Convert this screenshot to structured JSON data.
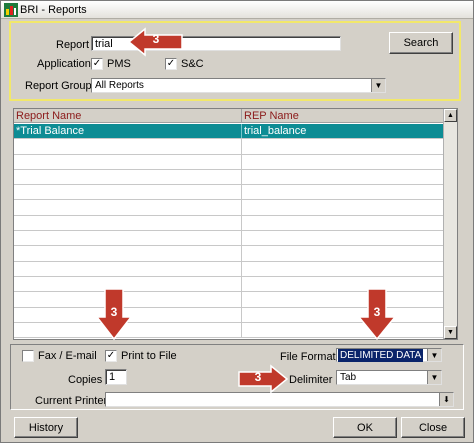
{
  "window": {
    "title": "BRI - Reports"
  },
  "criteria": {
    "report_label": "Report",
    "report_value": "trial",
    "search_button": "Search",
    "application_label": "Application",
    "pms_label": "PMS",
    "pms_checked": true,
    "sc_label": "S&C",
    "sc_checked": true,
    "report_group_label": "Report Group",
    "report_group_value": "All Reports"
  },
  "grid": {
    "columns": [
      "Report Name",
      "REP Name"
    ],
    "rows": [
      {
        "report_name": "*Trial Balance",
        "rep_name": "trial_balance",
        "selected": true
      },
      {
        "report_name": "",
        "rep_name": ""
      },
      {
        "report_name": "",
        "rep_name": ""
      },
      {
        "report_name": "",
        "rep_name": ""
      },
      {
        "report_name": "",
        "rep_name": ""
      },
      {
        "report_name": "",
        "rep_name": ""
      },
      {
        "report_name": "",
        "rep_name": ""
      },
      {
        "report_name": "",
        "rep_name": ""
      },
      {
        "report_name": "",
        "rep_name": ""
      },
      {
        "report_name": "",
        "rep_name": ""
      },
      {
        "report_name": "",
        "rep_name": ""
      },
      {
        "report_name": "",
        "rep_name": ""
      },
      {
        "report_name": "",
        "rep_name": ""
      },
      {
        "report_name": "",
        "rep_name": ""
      }
    ]
  },
  "options": {
    "fax_label": "Fax / E-mail",
    "fax_checked": false,
    "print_to_file_label": "Print to File",
    "print_to_file_checked": true,
    "file_format_label": "File Format",
    "file_format_value": "DELIMITED DATA",
    "copies_label": "Copies",
    "copies_value": "1",
    "delimiter_label": "Delimiter",
    "delimiter_value": "Tab",
    "current_printer_label": "Current Printer",
    "current_printer_value": ""
  },
  "footer": {
    "history_button": "History",
    "ok_button": "OK",
    "close_button": "Close"
  },
  "callouts": {
    "label": "3",
    "color": "#c0392b"
  },
  "colors": {
    "criteria_border": "#f2e86a",
    "selected_row": "#0d8c94",
    "header_text": "#8b1a1a",
    "dialog_bg": "#d4d0c8"
  }
}
